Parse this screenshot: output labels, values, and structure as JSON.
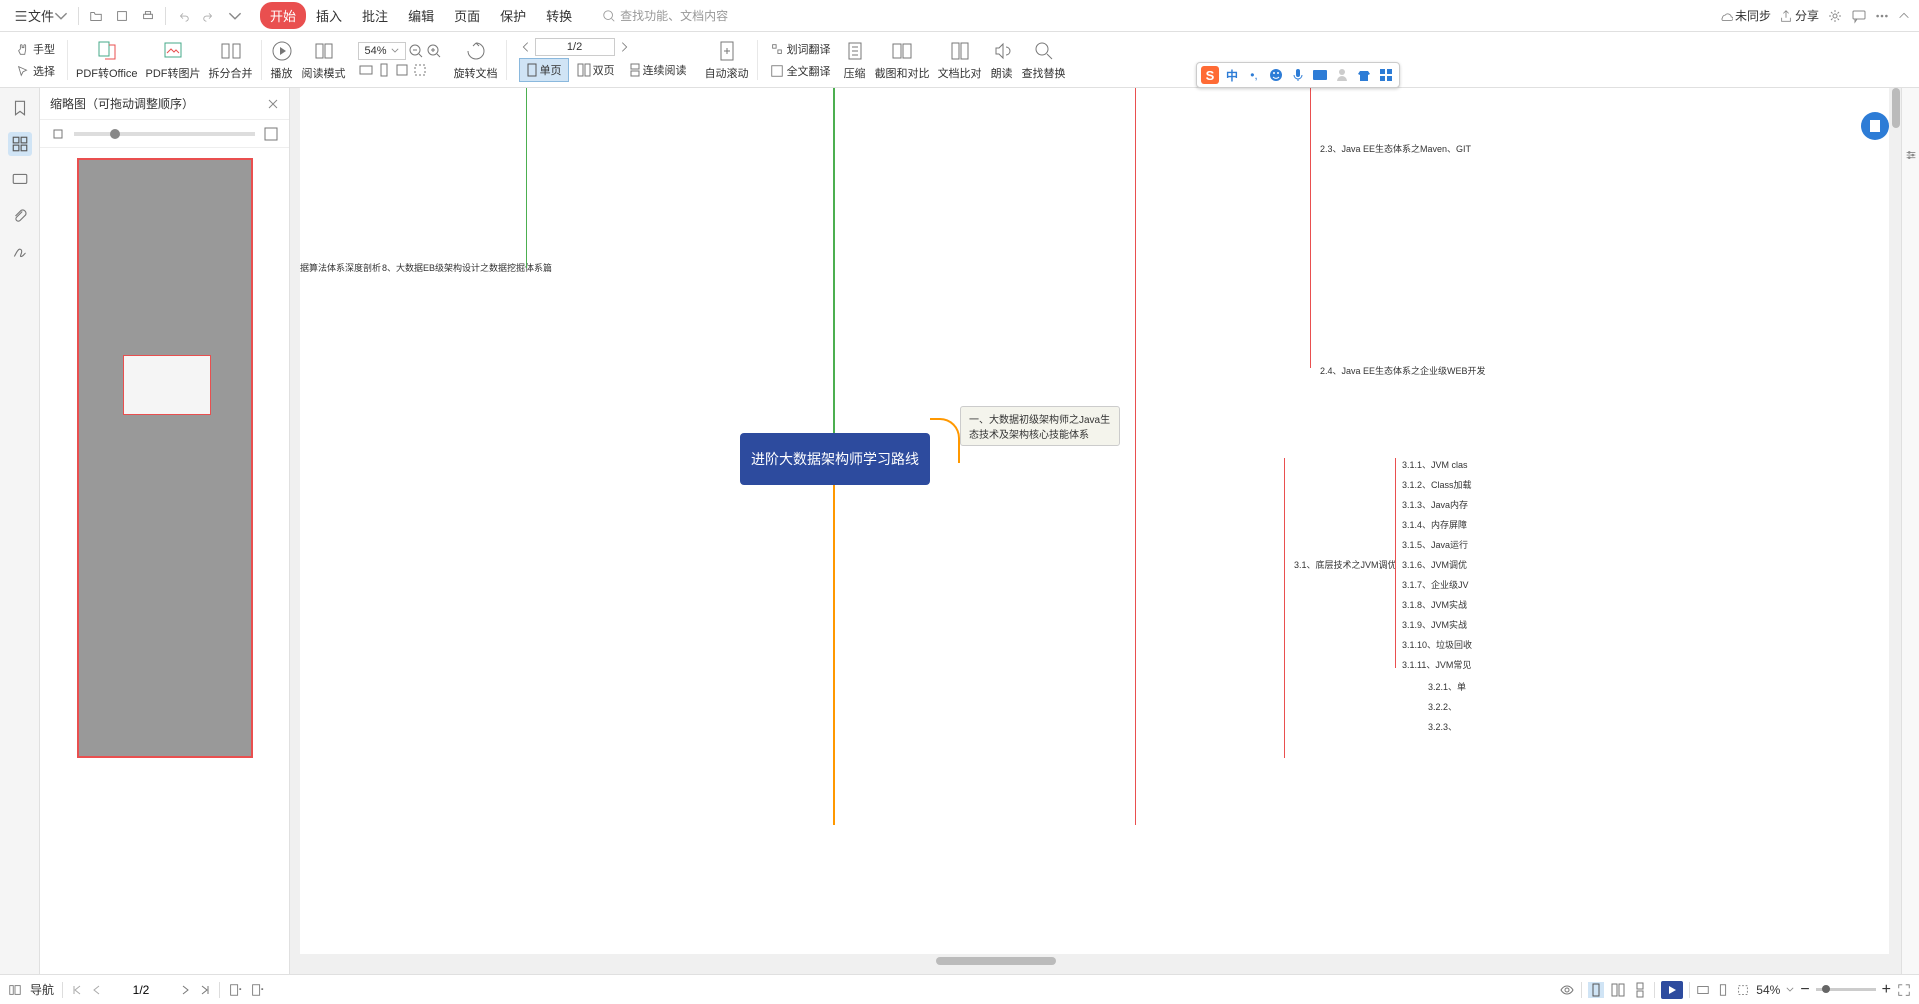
{
  "top_menu": {
    "file_label": "文件",
    "tabs": [
      "开始",
      "插入",
      "批注",
      "编辑",
      "页面",
      "保护",
      "转换"
    ],
    "active_tab": 0,
    "search_placeholder": "查找功能、文档内容",
    "sync_label": "未同步",
    "share_label": "分享"
  },
  "ribbon": {
    "hand_tool": "手型",
    "select_tool": "选择",
    "pdf_to_office": "PDF转Office",
    "pdf_to_image": "PDF转图片",
    "split_merge": "拆分合并",
    "play": "播放",
    "read_mode": "阅读模式",
    "zoom_value": "54%",
    "rotate_doc": "旋转文档",
    "single_page": "单页",
    "double_page": "双页",
    "continuous": "连续阅读",
    "page_indicator": "1/2",
    "auto_scroll": "自动滚动",
    "word_translate": "划词翻译",
    "full_translate": "全文翻译",
    "compress": "压缩",
    "screenshot_compare": "截图和对比",
    "doc_compare": "文档比对",
    "read_aloud": "朗读",
    "find_replace": "查找替换"
  },
  "thumbnail": {
    "title": "缩略图（可拖动调整顺序）"
  },
  "mindmap": {
    "center": "进阶大数据架构师学习路线",
    "left_node_1": "据算法体系深度剖析",
    "left_node_2": "8、大数据EB级架构设计之数据挖掘体系篇",
    "right_node_1": "一、大数据初级架构师之Java生态技术及架构核心技能体系",
    "right_top_1": "2.3、Java EE生态体系之Maven、GIT",
    "right_top_2": "2.4、Java EE生态体系之企业级WEB开发",
    "right_section": "3.1、底层技术之JVM调优",
    "right_items": [
      "3.1.1、JVM clas",
      "3.1.2、Class加载",
      "3.1.3、Java内存",
      "3.1.4、内存屏障",
      "3.1.5、Java运行",
      "3.1.6、JVM调优",
      "3.1.7、企业级JV",
      "3.1.8、JVM实战",
      "3.1.9、JVM实战",
      "3.1.10、垃圾回收",
      "3.1.11、JVM常见"
    ],
    "right_items_2": [
      "3.2.1、单",
      "3.2.2、",
      "3.2.3、"
    ]
  },
  "status": {
    "nav_label": "导航",
    "page_indicator": "1/2",
    "zoom_label": "54%"
  }
}
